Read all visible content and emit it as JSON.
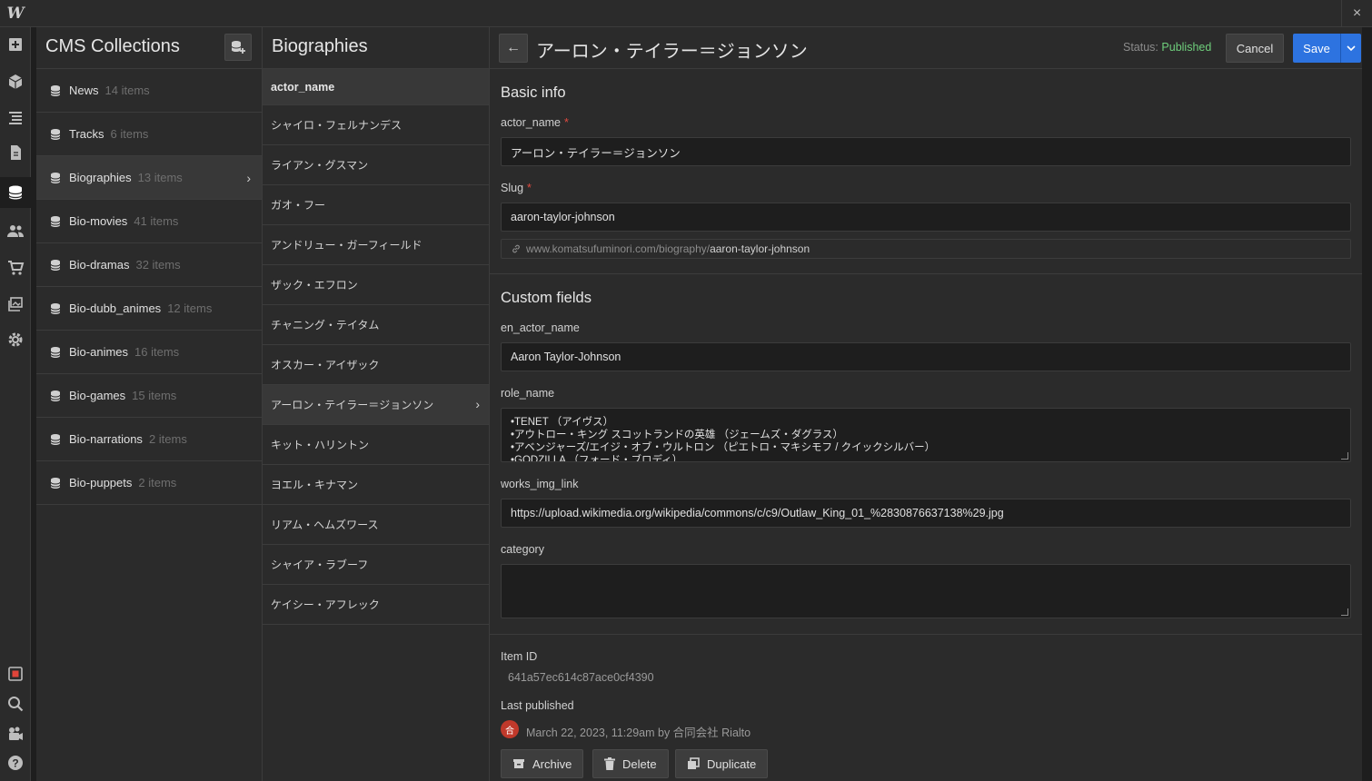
{
  "app": {
    "logo": "W",
    "close_icon": "×"
  },
  "rail": {
    "icons": [
      "add-icon",
      "box-icon",
      "navigator-icon",
      "pages-icon",
      "cms-icon",
      "users-icon",
      "ecommerce-icon",
      "assets-icon",
      "settings-icon",
      "audit-icon",
      "search-icon",
      "video-icon",
      "help-icon"
    ]
  },
  "collections": {
    "title": "CMS Collections",
    "items": [
      {
        "name": "News",
        "count": "14 items"
      },
      {
        "name": "Tracks",
        "count": "6 items"
      },
      {
        "name": "Biographies",
        "count": "13 items"
      },
      {
        "name": "Bio-movies",
        "count": "41 items"
      },
      {
        "name": "Bio-dramas",
        "count": "32 items"
      },
      {
        "name": "Bio-dubb_animes",
        "count": "12 items"
      },
      {
        "name": "Bio-animes",
        "count": "16 items"
      },
      {
        "name": "Bio-games",
        "count": "15 items"
      },
      {
        "name": "Bio-narrations",
        "count": "2 items"
      },
      {
        "name": "Bio-puppets",
        "count": "2 items"
      }
    ],
    "active_index": 2
  },
  "items_panel": {
    "title": "Biographies",
    "column": "actor_name",
    "rows": [
      "シャイロ・フェルナンデス",
      "ライアン・グスマン",
      "ガオ・フー",
      "アンドリュー・ガーフィールド",
      "ザック・エフロン",
      "チャニング・テイタム",
      "オスカー・アイザック",
      "アーロン・テイラー＝ジョンソン",
      "キット・ハリントン",
      "ヨエル・キナマン",
      "リアム・ヘムズワース",
      "シャイア・ラブーフ",
      "ケイシー・アフレック"
    ],
    "active_index": 7
  },
  "editor": {
    "title": "アーロン・テイラー＝ジョンソン",
    "status_label": "Status:",
    "status_value": "Published",
    "cancel": "Cancel",
    "save": "Save",
    "basic_info": {
      "title": "Basic info",
      "actor_name_label": "actor_name",
      "actor_name_value": "アーロン・テイラー＝ジョンソン",
      "slug_label": "Slug",
      "slug_value": "aaron-taylor-johnson",
      "url_prefix": "www.komatsufuminori.com/biography/",
      "url_slug": "aaron-taylor-johnson"
    },
    "custom_fields": {
      "title": "Custom fields",
      "en_actor_name_label": "en_actor_name",
      "en_actor_name_value": "Aaron Taylor-Johnson",
      "role_name_label": "role_name",
      "role_name_lines": [
        "•TENET （アイヴス）",
        "•アウトロー・キング スコットランドの英雄 （ジェームズ・ダグラス）",
        "•アベンジャーズ/エイジ・オブ・ウルトロン （ピエトロ・マキシモフ / クイックシルバー）",
        "•GODZILLA （フォード・ブロディ）"
      ],
      "works_img_link_label": "works_img_link",
      "works_img_link_value": "https://upload.wikimedia.org/wikipedia/commons/c/c9/Outlaw_King_01_%2830876637138%29.jpg",
      "category_label": "category",
      "category_value": ""
    },
    "meta": {
      "item_id_label": "Item ID",
      "item_id_value": "641a57ec614c87ace0cf4390",
      "last_published_label": "Last published",
      "last_published_value": "March 22, 2023, 11:29am by 合同会社 Rialto",
      "avatar_char": "合"
    },
    "actions": {
      "archive": "Archive",
      "delete": "Delete",
      "duplicate": "Duplicate"
    }
  },
  "colors": {
    "accent": "#2d73e0",
    "published": "#6fcf7c",
    "required": "#e04a3f"
  }
}
